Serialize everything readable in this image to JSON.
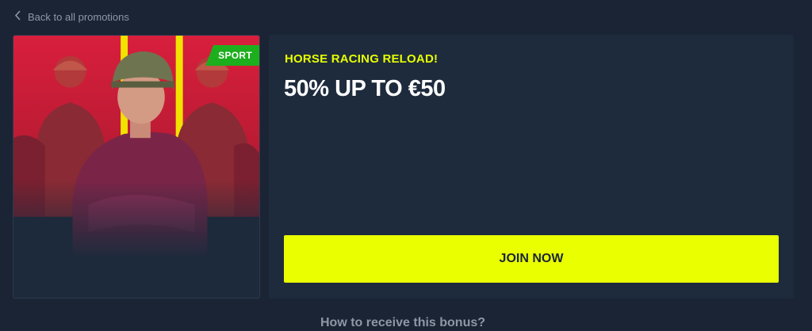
{
  "nav": {
    "back_label": "Back to all promotions",
    "back_icon": "chevron-left-icon"
  },
  "promo": {
    "badge": "SPORT",
    "subtitle": "HORSE RACING RELOAD!",
    "title": "50% UP TO €50",
    "cta_label": "JOIN NOW"
  },
  "section": {
    "how_to_heading": "How to receive this bonus?"
  },
  "colors": {
    "page_background": "#1a2434",
    "card_background": "#1e2b3d",
    "accent_yellow": "#eaff00",
    "badge_green": "#1dae1d",
    "muted_text": "#8d97a6"
  }
}
